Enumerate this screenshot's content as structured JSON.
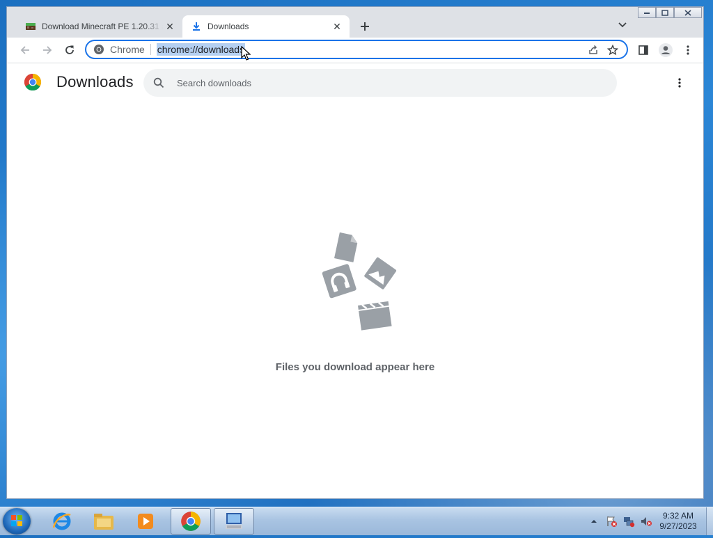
{
  "browser": {
    "tabs": [
      {
        "title": "Download Minecraft PE 1.20.31 a",
        "active": false,
        "favicon": "minecraft-icon"
      },
      {
        "title": "Downloads",
        "active": true,
        "favicon": "download-icon"
      }
    ],
    "omnibox": {
      "site_chip": "Chrome",
      "url": "chrome://downloads"
    }
  },
  "downloads_page": {
    "title": "Downloads",
    "search_placeholder": "Search downloads",
    "empty_message": "Files you download appear here"
  },
  "taskbar": {
    "pinned": [
      "internet-explorer-icon",
      "windows-explorer-icon",
      "media-player-icon",
      "chrome-icon",
      "remote-desktop-icon"
    ],
    "clock": {
      "time": "9:32 AM",
      "date": "9/27/2023"
    }
  },
  "colors": {
    "accent": "#1a73e8",
    "url_selection": "#b5d0f2",
    "illustration_gray": "#9aa0a6"
  }
}
